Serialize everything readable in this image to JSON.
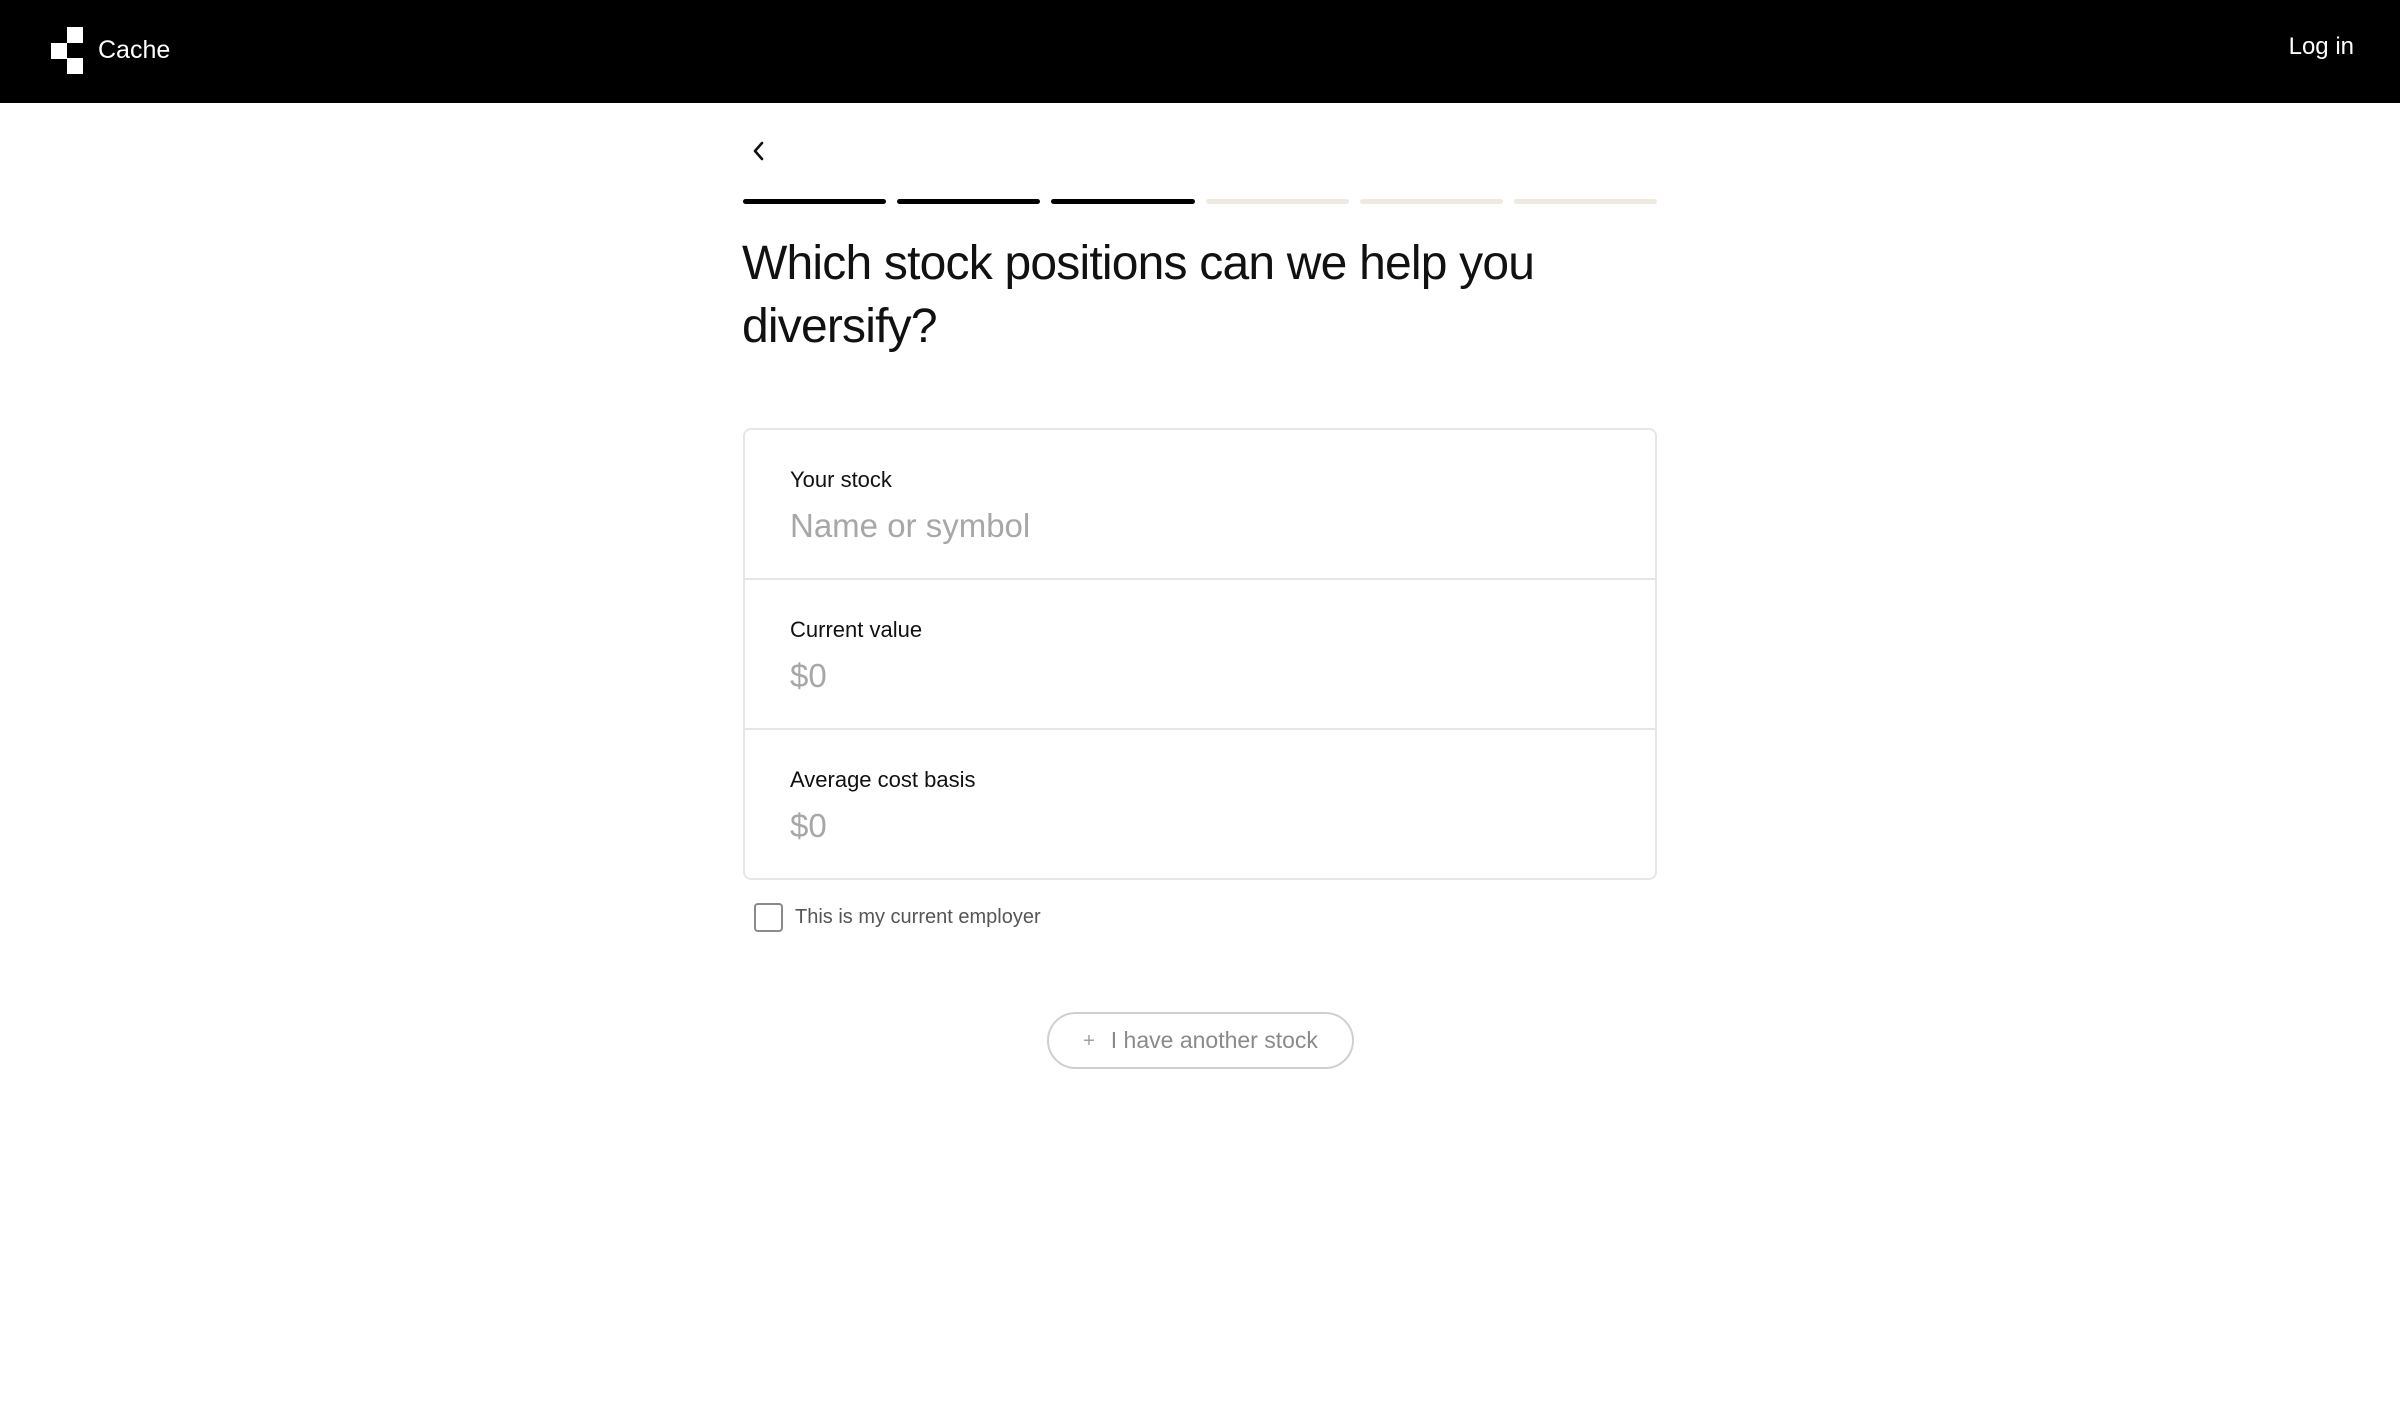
{
  "header": {
    "brand_name": "Cache",
    "login_label": "Log in"
  },
  "progress": {
    "total_steps": 6,
    "completed_steps": 3
  },
  "page": {
    "title": "Which stock positions can we help you diversify?"
  },
  "form": {
    "stock": {
      "label": "Your stock",
      "placeholder": "Name or symbol",
      "value": ""
    },
    "current_value": {
      "label": "Current value",
      "placeholder": "$0",
      "value": ""
    },
    "cost_basis": {
      "label": "Average cost basis",
      "placeholder": "$0",
      "value": ""
    },
    "employer_checkbox": {
      "label": "This is my current employer",
      "checked": false
    }
  },
  "actions": {
    "add_stock_icon": "plus-icon",
    "add_stock_label": "I have another stock"
  },
  "colors": {
    "header_bg": "#000000",
    "progress_done": "#000000",
    "progress_pending": "#eeeae2"
  }
}
